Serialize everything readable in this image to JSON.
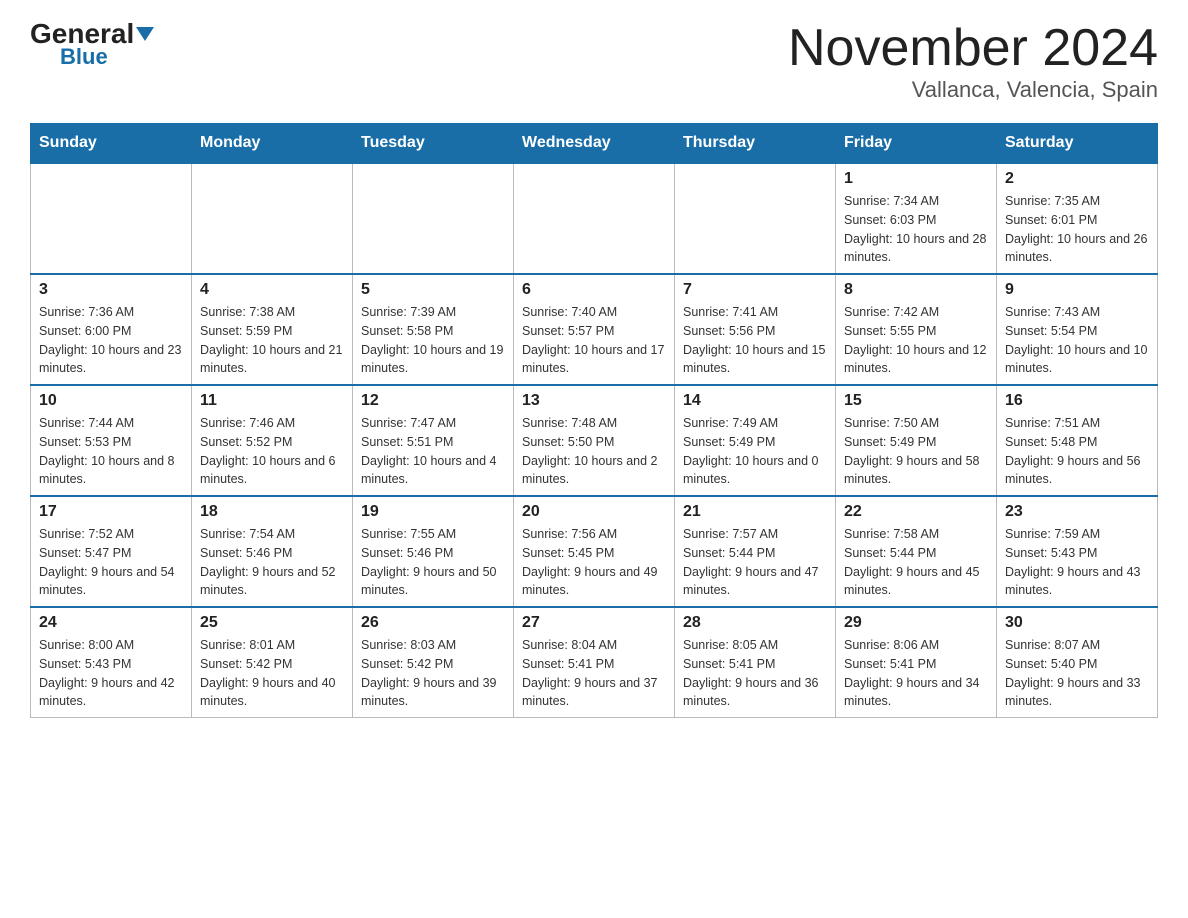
{
  "header": {
    "logo_general": "General",
    "logo_blue": "Blue",
    "month_title": "November 2024",
    "location": "Vallanca, Valencia, Spain"
  },
  "weekdays": [
    "Sunday",
    "Monday",
    "Tuesday",
    "Wednesday",
    "Thursday",
    "Friday",
    "Saturday"
  ],
  "weeks": [
    [
      {
        "day": "",
        "info": ""
      },
      {
        "day": "",
        "info": ""
      },
      {
        "day": "",
        "info": ""
      },
      {
        "day": "",
        "info": ""
      },
      {
        "day": "",
        "info": ""
      },
      {
        "day": "1",
        "info": "Sunrise: 7:34 AM\nSunset: 6:03 PM\nDaylight: 10 hours and 28 minutes."
      },
      {
        "day": "2",
        "info": "Sunrise: 7:35 AM\nSunset: 6:01 PM\nDaylight: 10 hours and 26 minutes."
      }
    ],
    [
      {
        "day": "3",
        "info": "Sunrise: 7:36 AM\nSunset: 6:00 PM\nDaylight: 10 hours and 23 minutes."
      },
      {
        "day": "4",
        "info": "Sunrise: 7:38 AM\nSunset: 5:59 PM\nDaylight: 10 hours and 21 minutes."
      },
      {
        "day": "5",
        "info": "Sunrise: 7:39 AM\nSunset: 5:58 PM\nDaylight: 10 hours and 19 minutes."
      },
      {
        "day": "6",
        "info": "Sunrise: 7:40 AM\nSunset: 5:57 PM\nDaylight: 10 hours and 17 minutes."
      },
      {
        "day": "7",
        "info": "Sunrise: 7:41 AM\nSunset: 5:56 PM\nDaylight: 10 hours and 15 minutes."
      },
      {
        "day": "8",
        "info": "Sunrise: 7:42 AM\nSunset: 5:55 PM\nDaylight: 10 hours and 12 minutes."
      },
      {
        "day": "9",
        "info": "Sunrise: 7:43 AM\nSunset: 5:54 PM\nDaylight: 10 hours and 10 minutes."
      }
    ],
    [
      {
        "day": "10",
        "info": "Sunrise: 7:44 AM\nSunset: 5:53 PM\nDaylight: 10 hours and 8 minutes."
      },
      {
        "day": "11",
        "info": "Sunrise: 7:46 AM\nSunset: 5:52 PM\nDaylight: 10 hours and 6 minutes."
      },
      {
        "day": "12",
        "info": "Sunrise: 7:47 AM\nSunset: 5:51 PM\nDaylight: 10 hours and 4 minutes."
      },
      {
        "day": "13",
        "info": "Sunrise: 7:48 AM\nSunset: 5:50 PM\nDaylight: 10 hours and 2 minutes."
      },
      {
        "day": "14",
        "info": "Sunrise: 7:49 AM\nSunset: 5:49 PM\nDaylight: 10 hours and 0 minutes."
      },
      {
        "day": "15",
        "info": "Sunrise: 7:50 AM\nSunset: 5:49 PM\nDaylight: 9 hours and 58 minutes."
      },
      {
        "day": "16",
        "info": "Sunrise: 7:51 AM\nSunset: 5:48 PM\nDaylight: 9 hours and 56 minutes."
      }
    ],
    [
      {
        "day": "17",
        "info": "Sunrise: 7:52 AM\nSunset: 5:47 PM\nDaylight: 9 hours and 54 minutes."
      },
      {
        "day": "18",
        "info": "Sunrise: 7:54 AM\nSunset: 5:46 PM\nDaylight: 9 hours and 52 minutes."
      },
      {
        "day": "19",
        "info": "Sunrise: 7:55 AM\nSunset: 5:46 PM\nDaylight: 9 hours and 50 minutes."
      },
      {
        "day": "20",
        "info": "Sunrise: 7:56 AM\nSunset: 5:45 PM\nDaylight: 9 hours and 49 minutes."
      },
      {
        "day": "21",
        "info": "Sunrise: 7:57 AM\nSunset: 5:44 PM\nDaylight: 9 hours and 47 minutes."
      },
      {
        "day": "22",
        "info": "Sunrise: 7:58 AM\nSunset: 5:44 PM\nDaylight: 9 hours and 45 minutes."
      },
      {
        "day": "23",
        "info": "Sunrise: 7:59 AM\nSunset: 5:43 PM\nDaylight: 9 hours and 43 minutes."
      }
    ],
    [
      {
        "day": "24",
        "info": "Sunrise: 8:00 AM\nSunset: 5:43 PM\nDaylight: 9 hours and 42 minutes."
      },
      {
        "day": "25",
        "info": "Sunrise: 8:01 AM\nSunset: 5:42 PM\nDaylight: 9 hours and 40 minutes."
      },
      {
        "day": "26",
        "info": "Sunrise: 8:03 AM\nSunset: 5:42 PM\nDaylight: 9 hours and 39 minutes."
      },
      {
        "day": "27",
        "info": "Sunrise: 8:04 AM\nSunset: 5:41 PM\nDaylight: 9 hours and 37 minutes."
      },
      {
        "day": "28",
        "info": "Sunrise: 8:05 AM\nSunset: 5:41 PM\nDaylight: 9 hours and 36 minutes."
      },
      {
        "day": "29",
        "info": "Sunrise: 8:06 AM\nSunset: 5:41 PM\nDaylight: 9 hours and 34 minutes."
      },
      {
        "day": "30",
        "info": "Sunrise: 8:07 AM\nSunset: 5:40 PM\nDaylight: 9 hours and 33 minutes."
      }
    ]
  ]
}
